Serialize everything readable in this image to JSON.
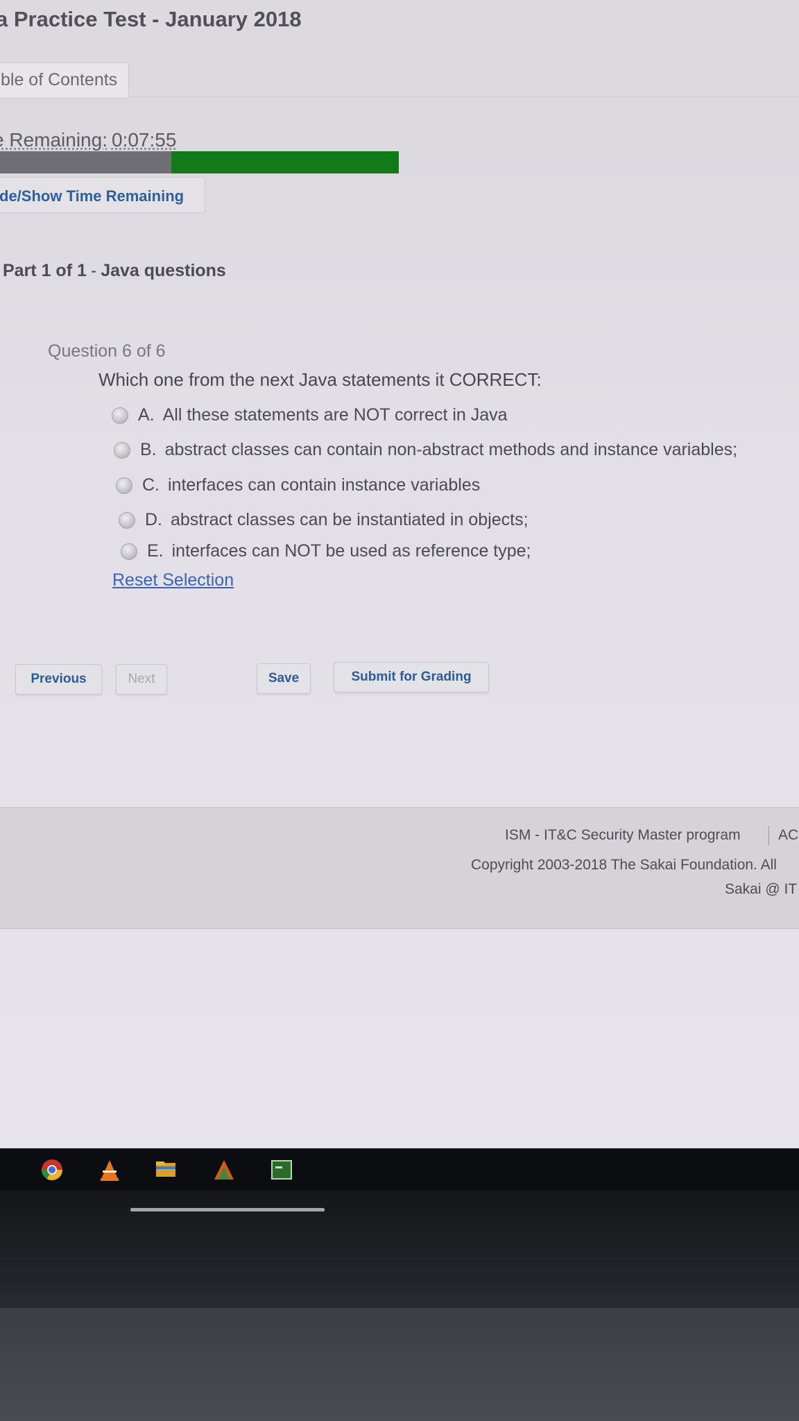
{
  "test": {
    "title": "a Practice Test - January 2018",
    "toc_label": "ble of Contents"
  },
  "timer": {
    "label": "e Remaining:",
    "value": "0:07:55",
    "elapsed_fraction": 0.43,
    "toggle_label": "de/Show Time Remaining"
  },
  "part": {
    "label": "Part 1 of 1",
    "separator": "-",
    "name": "Java questions"
  },
  "question": {
    "count": "Question 6 of 6",
    "text": "Which one from the next Java statements it CORRECT:",
    "options": [
      {
        "letter": "A.",
        "text": "All these statements are NOT correct in Java"
      },
      {
        "letter": "B.",
        "text": "abstract classes can contain non-abstract methods and instance variables;"
      },
      {
        "letter": "C.",
        "text": "interfaces can contain instance variables"
      },
      {
        "letter": "D.",
        "text": "abstract classes can be instantiated in objects;"
      },
      {
        "letter": "E.",
        "text": "interfaces can NOT be used as reference type;"
      }
    ],
    "reset_label": "Reset Selection"
  },
  "nav": {
    "previous": "Previous",
    "next": "Next",
    "save": "Save",
    "submit": "Submit for Grading"
  },
  "footer": {
    "program": "ISM - IT&C Security Master program",
    "program_next": "AC",
    "copyright": "Copyright 2003-2018 The Sakai Foundation. All",
    "site": "Sakai @ IT"
  },
  "colors": {
    "progress_remaining": "#137a1a",
    "progress_elapsed": "#6e6f74",
    "link": "#3a63b4",
    "button_text": "#2c5c98"
  },
  "taskbar_icons": [
    "chrome-icon",
    "vlc-icon",
    "folder-icon",
    "app-icon",
    "terminal-icon"
  ]
}
